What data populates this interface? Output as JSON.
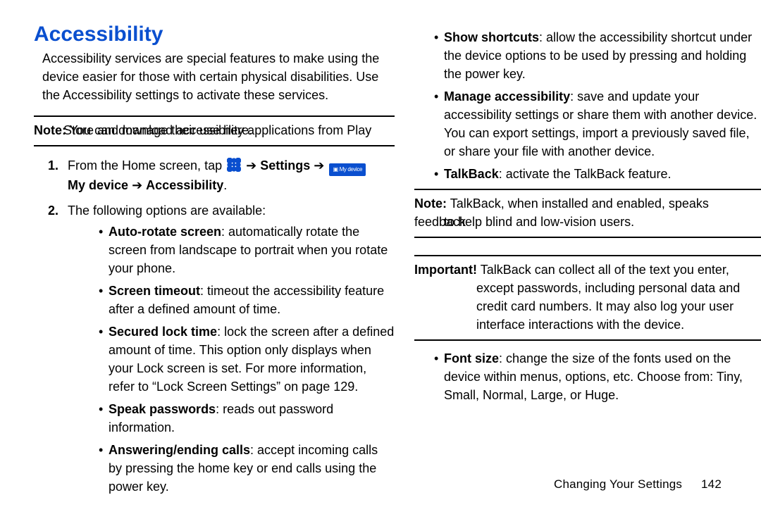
{
  "title": "Accessibility",
  "intro": "Accessibility services are special features to make using the device easier for those with certain physical disabilities. Use the Accessibility settings to activate these services.",
  "note1": {
    "label": "Note:",
    "line1": "You can download accessibility applications from Play",
    "line2": "Store and manage their use here."
  },
  "step1": {
    "num": "1.",
    "pre": "From the Home screen, tap",
    "settings": "Settings",
    "mydevice": "My device",
    "accessibility": "Accessibility",
    "period": "."
  },
  "step2": {
    "num": "2.",
    "text": "The following options are available:"
  },
  "left_bullets": {
    "b1_head": "Auto-rotate screen",
    "b1_rest": ": automatically rotate the screen from landscape to portrait when you rotate your phone.",
    "b2_head": "Screen timeout",
    "b2_rest": ": timeout the accessibility feature after a defined amount of time.",
    "b3_head": "Secured lock time",
    "b3_rest": ": lock the screen after a defined amount of time. This option only displays when your Lock screen is set. For more information, refer to",
    "b3_xref": "“Lock Screen Settings”",
    "b3_on": "on page 129.",
    "b4_head": "Speak passwords",
    "b4_rest": ": reads out password information.",
    "b5_head": "Answering/ending calls",
    "b5_rest": ": accept incoming calls by pressing the home key or end calls using the power key."
  },
  "right_bullets_top": {
    "b1_head": "Show shortcuts",
    "b1_rest": ": allow the accessibility shortcut under the device options to be used by pressing and holding the power key.",
    "b2_head": "Manage accessibility",
    "b2_rest": ": save and update your accessibility settings or share them with another device. You can export settings, import a previously saved file, or share your file with another device.",
    "b3_head": "TalkBack",
    "b3_rest": ": activate the TalkBack feature."
  },
  "note2": {
    "label": "Note:",
    "line1": "TalkBack, when installed and enabled, speaks feedback",
    "line2": "to help blind and low-vision users."
  },
  "important": {
    "label": "Important!",
    "line1": "TalkBack can collect all of the text you enter,",
    "line2": "except passwords, including personal data and",
    "line3": "credit card numbers. It may also log your user",
    "line4": "interface interactions with the device."
  },
  "right_bullets_bottom": {
    "b1_head": "Font size",
    "b1_rest": ": change the size of the fonts used on the device within menus, options, etc. Choose from: Tiny, Small, Normal, Large, or Huge."
  },
  "footer": {
    "section": "Changing Your Settings",
    "page": "142"
  }
}
